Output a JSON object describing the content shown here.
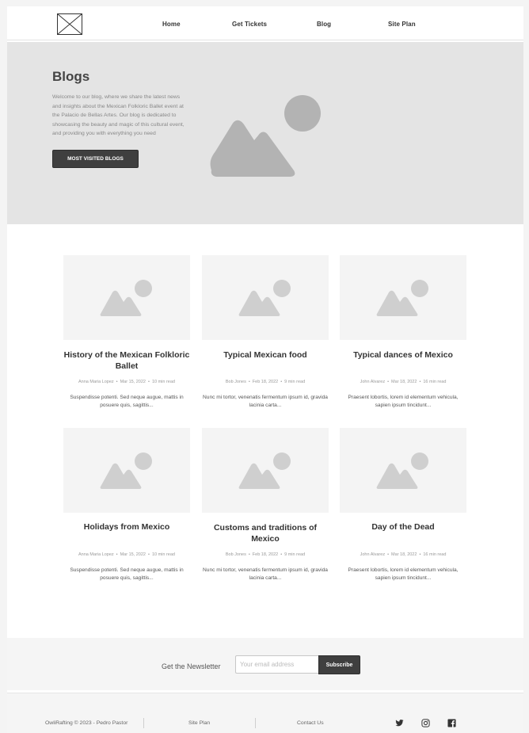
{
  "header": {
    "nav": [
      "Home",
      "Get Tickets",
      "Blog",
      "Site Plan"
    ]
  },
  "hero": {
    "title": "Blogs",
    "text": "Welcome to our blog, where we share the latest news and insights about the Mexican Folkloric Ballet event at the Palacio de Bellas Artes. Our blog is dedicated to showcasing the beauty and magic of this cultural event, and providing you with everything you need",
    "button": "MOST VISITED BLOGS"
  },
  "posts": [
    {
      "title": "History of the Mexican Folkloric Ballet",
      "author": "Anna Maria Lopez",
      "date": "Mar 15, 2022",
      "read": "10 min read",
      "excerpt": "Suspendisse potenti. Sed neque augue, mattis in posuere quis, sagittis..."
    },
    {
      "title": "Typical Mexican food",
      "author": "Bob Jones",
      "date": "Feb 18, 2022",
      "read": "9 min read",
      "excerpt": "Nunc mi tortor, venenatis fermentum ipsum id, gravida lacinia carta..."
    },
    {
      "title": "Typical dances of Mexico",
      "author": "John Alvarez",
      "date": "Mar 18, 2022",
      "read": "16 min read",
      "excerpt": "Praesent lobortis, lorem id elementum vehicula, sapien ipsum tincidunt..."
    },
    {
      "title": "Holidays from Mexico",
      "author": "Anna Maria Lopez",
      "date": "Mar 15, 2022",
      "read": "10 min read",
      "excerpt": "Suspendisse potenti. Sed neque augue, mattis in posuere quis, sagittis..."
    },
    {
      "title": "Customs and traditions of Mexico",
      "author": "Bob Jones",
      "date": "Feb 18, 2022",
      "read": "9 min read",
      "excerpt": "Nunc mi tortor, venenatis fermentum ipsum id, gravida lacinia carta..."
    },
    {
      "title": "Day of the Dead",
      "author": "John Alvarez",
      "date": "Mar 18, 2022",
      "read": "16 min read",
      "excerpt": "Praesent lobortis, lorem id elementum vehicula, sapien ipsum tincidunt..."
    }
  ],
  "newsletter": {
    "label": "Get the Newsletter",
    "placeholder": "Your email address",
    "button": "Subscribe"
  },
  "footer": {
    "copyright": "OwliRafting © 2023 - Pedro Pastor",
    "links": [
      "Site Plan",
      "Contact Us"
    ],
    "social_icons": [
      "twitter-icon",
      "instagram-icon",
      "facebook-icon"
    ]
  },
  "colors": {
    "accent": "#3f3f3f",
    "hero_bg": "#e4e4e4",
    "placeholder_fill": "#cfcfcf"
  }
}
